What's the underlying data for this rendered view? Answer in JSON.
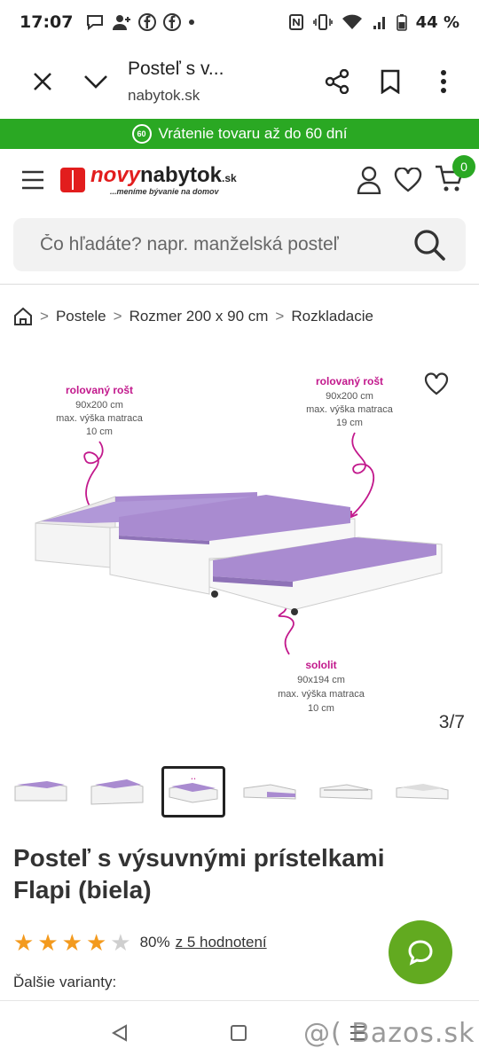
{
  "status_bar": {
    "time": "17:07",
    "battery": "44 %",
    "icons": [
      "chat-bubble-icon",
      "add-person-icon",
      "facebook-icon",
      "facebook-icon",
      "dot-icon",
      "nfc-icon",
      "vibrate-icon",
      "wifi-icon",
      "signal-icon",
      "battery-icon"
    ]
  },
  "browser": {
    "page_title": "Posteľ s v...",
    "url": "nabytok.sk",
    "icons": [
      "close-icon",
      "chevron-down-icon",
      "share-icon",
      "bookmark-icon",
      "more-icon"
    ]
  },
  "promo": {
    "badge": "60",
    "text": "Vrátenie tovaru až do 60 dní",
    "color": "#2aa823"
  },
  "site_header": {
    "logo_novy": "novy",
    "logo_nabytok": "nabytok",
    "logo_sk": ".sk",
    "logo_tagline": "...meníme bývanie na domov",
    "cart_count": "0",
    "brand_color": "#e21d1d"
  },
  "search": {
    "placeholder": "Čo hľadáte? napr. manželská posteľ"
  },
  "breadcrumb": {
    "items": [
      "Postele",
      "Rozmer 200 x 90 cm",
      "Rozkladacie"
    ]
  },
  "gallery": {
    "annotation_left_title": "rolovaný rošt",
    "annotation_left_size": "90x200 cm",
    "annotation_left_note": "max. výška matraca",
    "annotation_left_height": "10 cm",
    "annotation_right_title": "rolovaný rošt",
    "annotation_right_size": "90x200 cm",
    "annotation_right_note": "max. výška matraca",
    "annotation_right_height": "19 cm",
    "annotation_bottom_title": "sololit",
    "annotation_bottom_size": "90x194 cm",
    "annotation_bottom_note": "max. výška matraca",
    "annotation_bottom_height": "10 cm",
    "pager": "3/7",
    "annotation_color": "#c2188c",
    "mattress_color": "#a98bd0"
  },
  "product": {
    "title": "Posteľ s výsuvnými prístelkami Flapi (biela)",
    "rating_percent": "80%",
    "rating_link": "z 5 hodnotení",
    "stars_filled": 4,
    "stars_total": 5,
    "variants_label": "Ďalšie varianty:"
  },
  "watermark": "@( Bazos.sk",
  "chat_color": "#62aa20"
}
